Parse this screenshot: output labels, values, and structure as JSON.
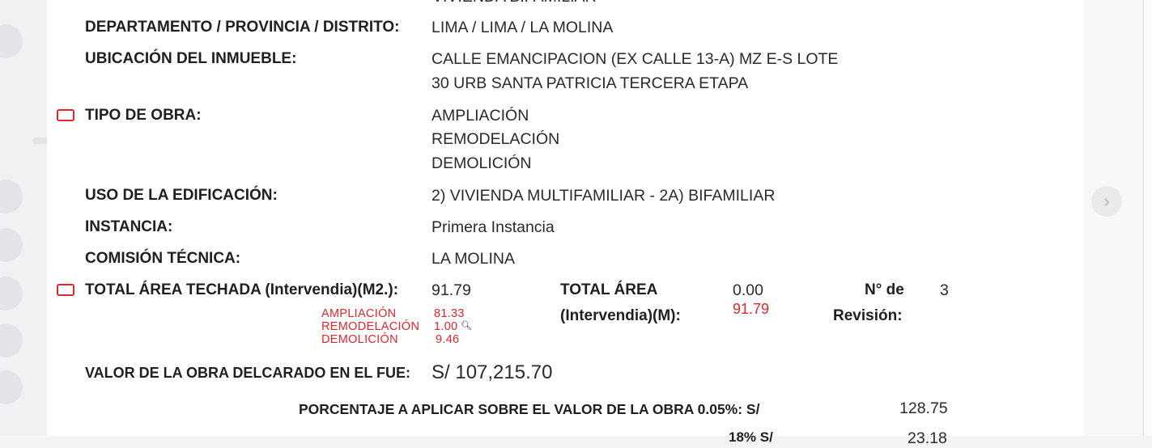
{
  "document": {
    "top_cut_text": "VIVIENDA BIFAMILIAR",
    "departamento": {
      "label": "DEPARTAMENTO / PROVINCIA / DISTRITO:",
      "value": "LIMA / LIMA / LA MOLINA"
    },
    "ubicacion": {
      "label": "UBICACIÓN DEL INMUEBLE:",
      "value_line1": "CALLE EMANCIPACION (EX CALLE 13-A) MZ E-S LOTE",
      "value_line2": "30 URB SANTA PATRICIA TERCERA ETAPA"
    },
    "tipo_obra": {
      "label": "TIPO DE OBRA:",
      "values": [
        "AMPLIACIÓN",
        "REMODELACIÓN",
        "DEMOLICIÓN"
      ]
    },
    "uso": {
      "label": "USO DE LA EDIFICACIÓN:",
      "value": "2) VIVIENDA MULTIFAMILIAR - 2A) BIFAMILIAR"
    },
    "instancia": {
      "label": "INSTANCIA:",
      "value": "Primera Instancia"
    },
    "comision": {
      "label": "COMISIÓN TÉCNICA:",
      "value": "LA MOLINA"
    },
    "area_techada": {
      "label": "TOTAL ÁREA TECHADA (Intervendia)(M2.):",
      "value": "91.79",
      "breakdown": [
        {
          "name": "AMPLIACIÓN",
          "value": "81.33"
        },
        {
          "name": "REMODELACIÓN",
          "value": "1.00"
        },
        {
          "name": "DEMOLICIÓN",
          "value": "9.46"
        }
      ]
    },
    "area_total": {
      "label_line1": "TOTAL ÁREA",
      "label_line2": "(Intervendia)(M):",
      "value": "0.00",
      "annotation": "91.79"
    },
    "revision": {
      "label_line1": "N° de",
      "label_line2": "Revisión:",
      "value": "3"
    },
    "valor_obra": {
      "label": "VALOR DE LA OBRA DELCARADO EN EL FUE:",
      "value": "S/ 107,215.70"
    },
    "porcentaje": {
      "label": "PORCENTAJE A APLICAR SOBRE EL VALOR DE LA OBRA 0.05%: S/",
      "value": "128.75"
    },
    "bottom_cut": {
      "label": "18% S/",
      "value": "23.18"
    }
  },
  "colors": {
    "annotation_red": "#e0262b"
  },
  "icons": {
    "nav_next": "chevron-right-icon",
    "checkbox_marks": "red-rectangle-mark",
    "zoom": "zoom-in-icon"
  }
}
